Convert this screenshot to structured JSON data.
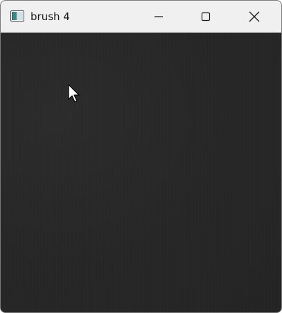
{
  "window": {
    "title": "brush 4",
    "canvas_color": "#262626",
    "titlebar_color": "#f0f0f0"
  },
  "controls": {
    "minimize_icon": "minimize-icon",
    "maximize_icon": "maximize-icon",
    "close_icon": "close-icon"
  },
  "cursor": {
    "icon": "arrow-pointer-icon"
  }
}
